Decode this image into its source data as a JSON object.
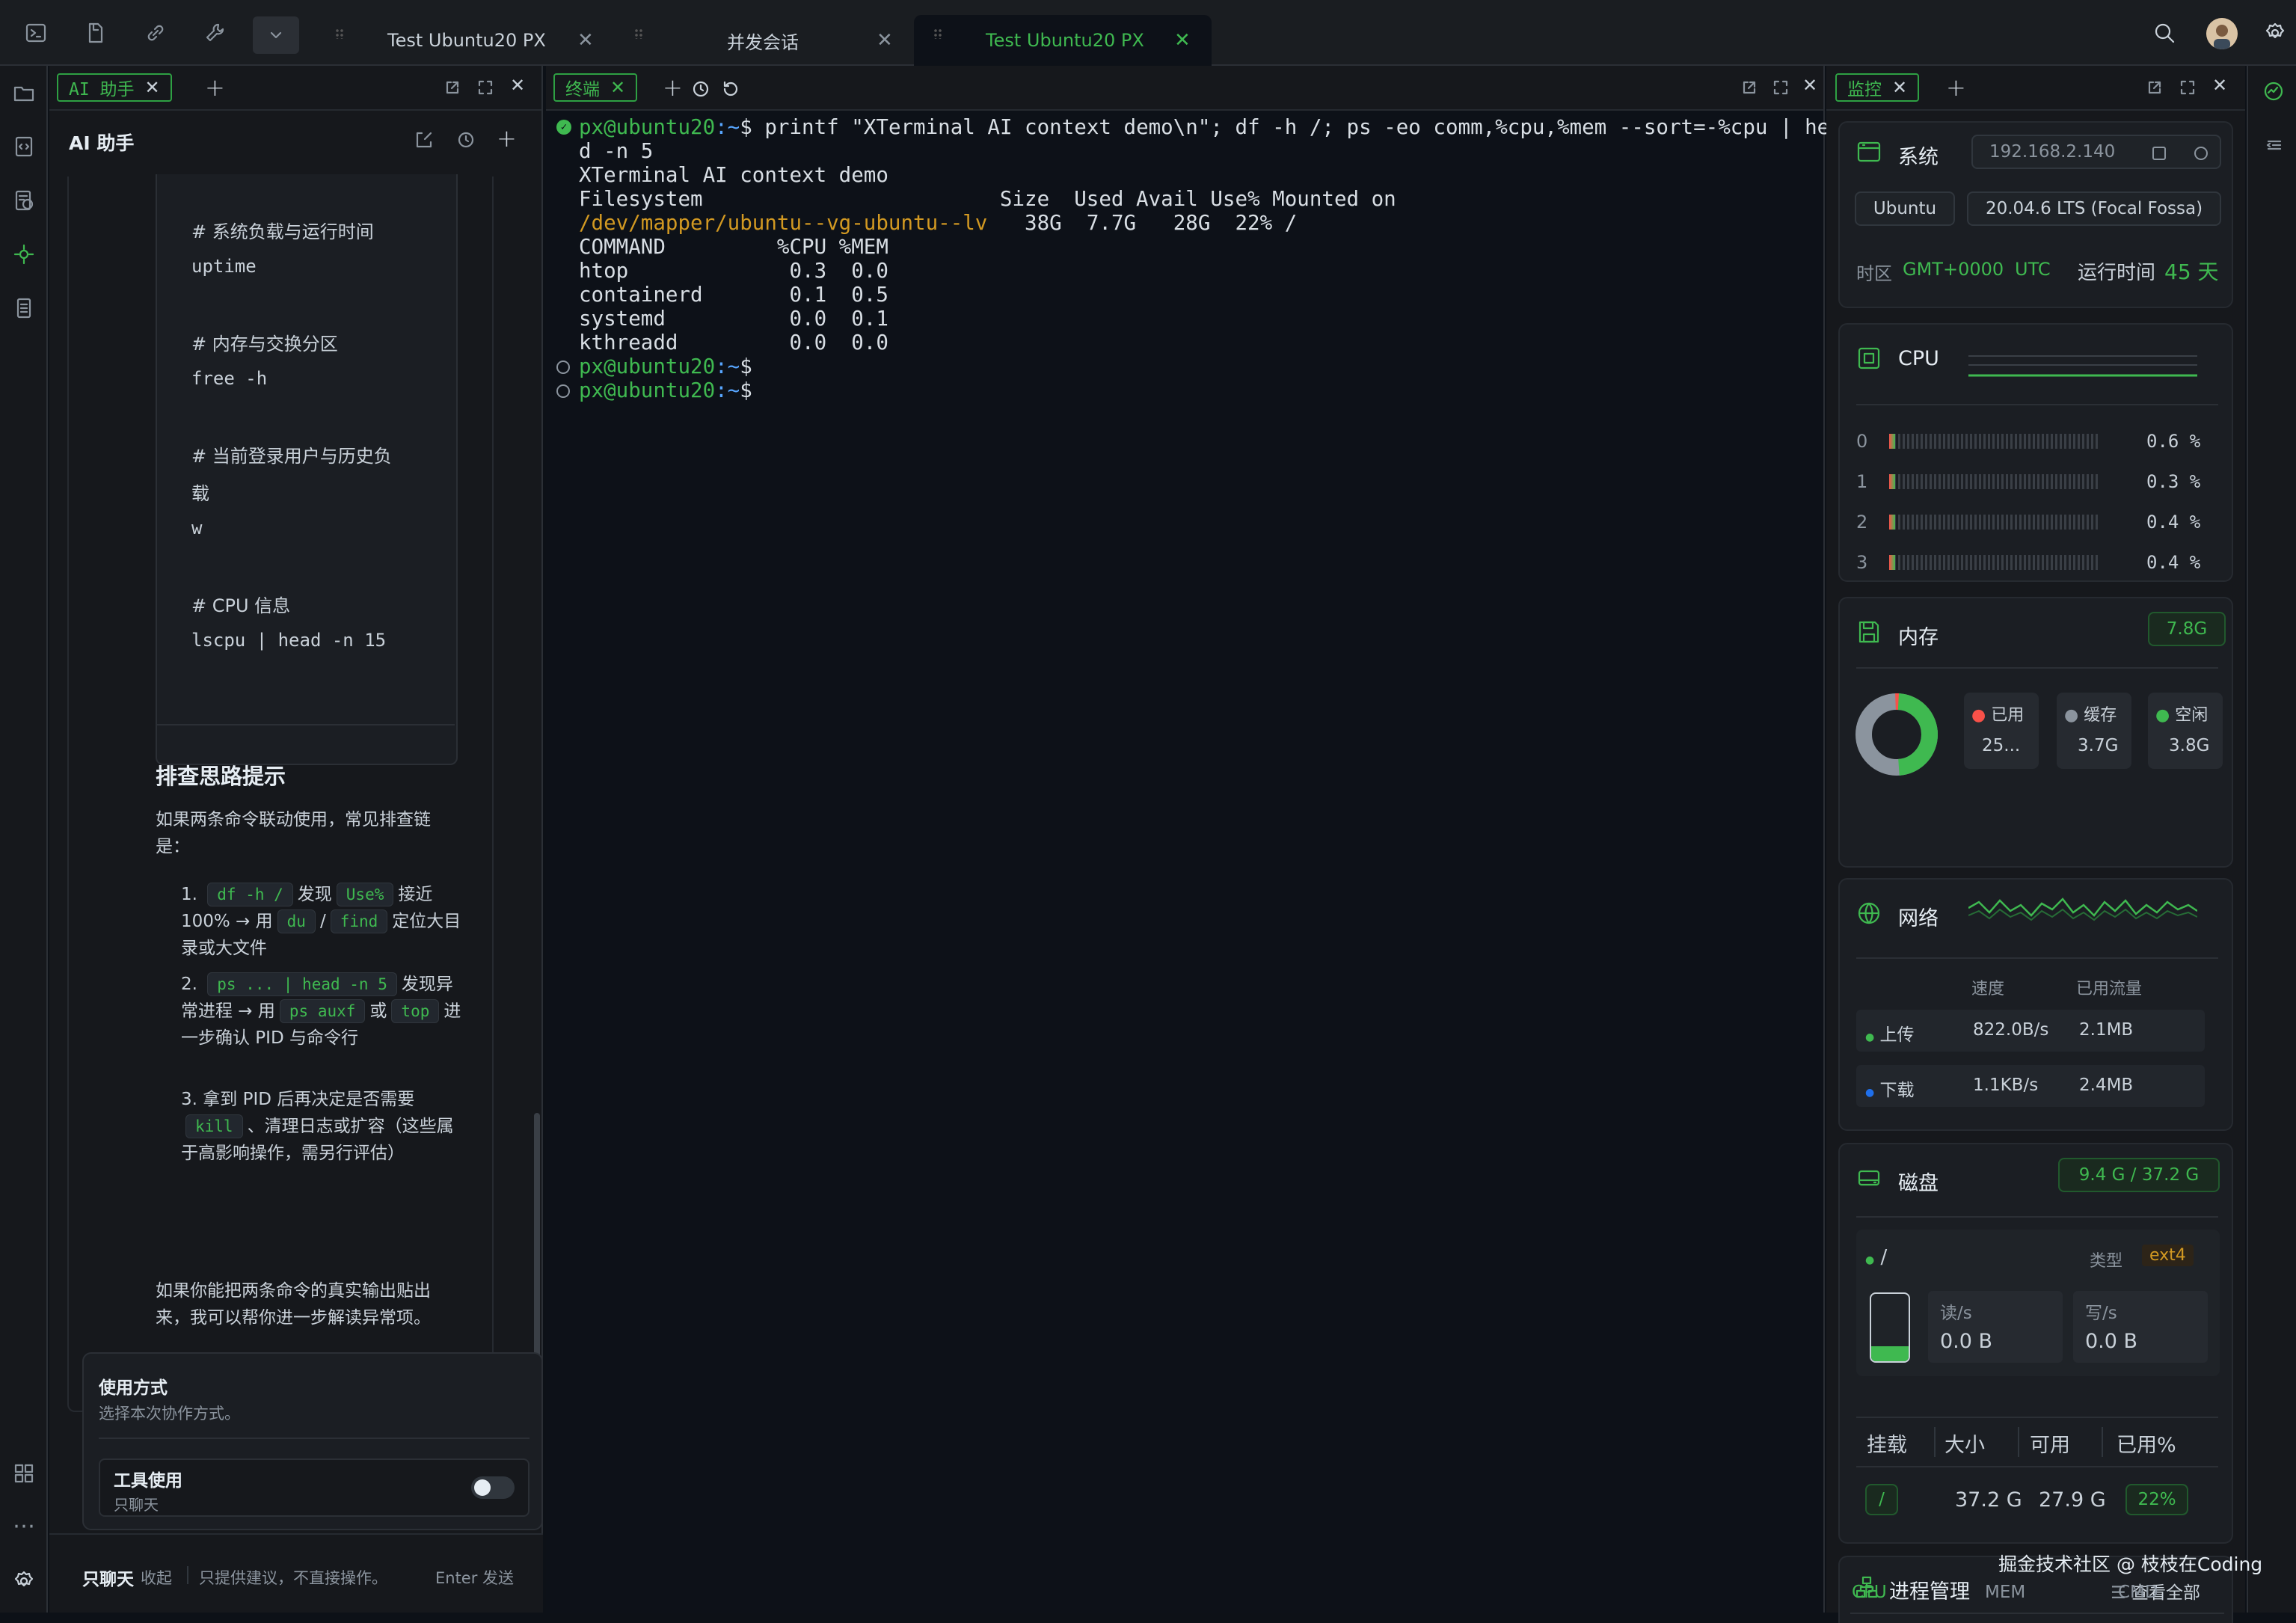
{
  "tabs": [
    {
      "label": "Test Ubuntu20 PX"
    },
    {
      "label": "并发会话"
    },
    {
      "label": "Test Ubuntu20 PX"
    }
  ],
  "ai": {
    "tab_label": "AI 助手",
    "title": "AI 助手",
    "code": [
      "# 系统负载与运行时间",
      "uptime",
      "# 内存与交换分区",
      "free -h",
      "# 当前登录用户与历史负",
      "载",
      "w",
      "# CPU 信息",
      "lscpu | head -n 15"
    ],
    "tips_title": "排查思路提示",
    "tips_intro": "如果两条命令联动使用，常见排查链是：",
    "steps": [
      {
        "n": "1.",
        "c1": "df -h /",
        "t1": "发现",
        "c2": "Use%",
        "t2": "接近 100% → 用",
        "c3": "du",
        "t3": "/",
        "c4": "find",
        "t4": "定位大目录或大文件"
      },
      {
        "n": "2.",
        "c1": "ps ... | head -n 5",
        "t1": "发现异常进程 → 用",
        "c2": "ps auxf",
        "t2": "或",
        "c3": "top",
        "t3": "进一步确认 PID 与命令行"
      },
      {
        "n": "3.",
        "t0": "拿到 PID 后再决定是否需要",
        "c1": "kill",
        "t1": "、清理日志或扩容（这些属于高影响操作，需另行评估）"
      }
    ],
    "closing": "如果你能把两条命令的真实输出贴出来，我可以帮你进一步解读异常项。",
    "usage_title": "使用方式",
    "usage_sub": "选择本次协作方式。",
    "tool_title": "工具使用",
    "tool_sub": "只聊天",
    "mode": "只聊天",
    "collapse": "收起",
    "mode_desc": "只提供建议，不直接操作。",
    "send": "Enter 发送"
  },
  "terminal": {
    "tab_label": "终端",
    "prompt_user": "px@ubuntu20",
    "prompt_path": ":~",
    "prompt_sym": "$ ",
    "cmd1": "printf \"XTerminal AI context demo\\n\"; df -h /; ps -eo comm,%cpu,%mem --sort=-%cpu | hea",
    "cmd1b": "d -n 5",
    "out": [
      "XTerminal AI context demo",
      "Filesystem                        Size  Used Avail Use% Mounted on"
    ],
    "df_dev": "/dev/mapper/ubuntu--vg-ubuntu--lv",
    "df_rest": "   38G  7.7G   28G  22% /",
    "ps": [
      "COMMAND         %CPU %MEM",
      "htop             0.3  0.0",
      "containerd       0.1  0.5",
      "systemd          0.0  0.1",
      "kthreadd         0.0  0.0"
    ]
  },
  "monitor": {
    "tab_label": "监控",
    "system": {
      "label": "系统",
      "ip": "192.168.2.140",
      "os": "Ubuntu",
      "version": "20.04.6 LTS (Focal Fossa)",
      "tz_label": "时区",
      "tz": "GMT+0000",
      "utc": "UTC",
      "uptime_label": "运行时间",
      "uptime": "45 天"
    },
    "cpu": {
      "label": "CPU",
      "cores": [
        {
          "id": "0",
          "pct": "0.6 %"
        },
        {
          "id": "1",
          "pct": "0.3 %"
        },
        {
          "id": "2",
          "pct": "0.4 %"
        },
        {
          "id": "3",
          "pct": "0.4 %"
        }
      ]
    },
    "mem": {
      "label": "内存",
      "total": "7.8G",
      "used_label": "已用",
      "used": "25...",
      "cache_label": "缓存",
      "cache": "3.7G",
      "free_label": "空闲",
      "free": "3.8G"
    },
    "net": {
      "label": "网络",
      "col_speed": "速度",
      "col_traffic": "已用流量",
      "up_label": "上传",
      "up_speed": "822.0B/s",
      "up_total": "2.1MB",
      "down_label": "下载",
      "down_speed": "1.1KB/s",
      "down_total": "2.4MB"
    },
    "disk": {
      "label": "磁盘",
      "usage": "9.4 G / 37.2 G",
      "mount": "/",
      "type_label": "类型",
      "type": "ext4",
      "read_label": "读/s",
      "read": "0.0 B",
      "write_label": "写/s",
      "write": "0.0 B",
      "cols": [
        "挂载",
        "大小",
        "可用",
        "已用%"
      ],
      "row": {
        "mount": "/",
        "size": "37.2 G",
        "avail": "27.9 G",
        "used": "22%"
      }
    },
    "proc": {
      "label": "进程管理",
      "view_all": "查看全部",
      "tabs": [
        "CPU",
        "MEM",
        "CMD"
      ]
    }
  },
  "watermark": "掘金技术社区 @ 枝枝在Coding",
  "colors": {
    "accent": "#3fb950",
    "bg": "#0d1117",
    "panel": "#16181c"
  }
}
